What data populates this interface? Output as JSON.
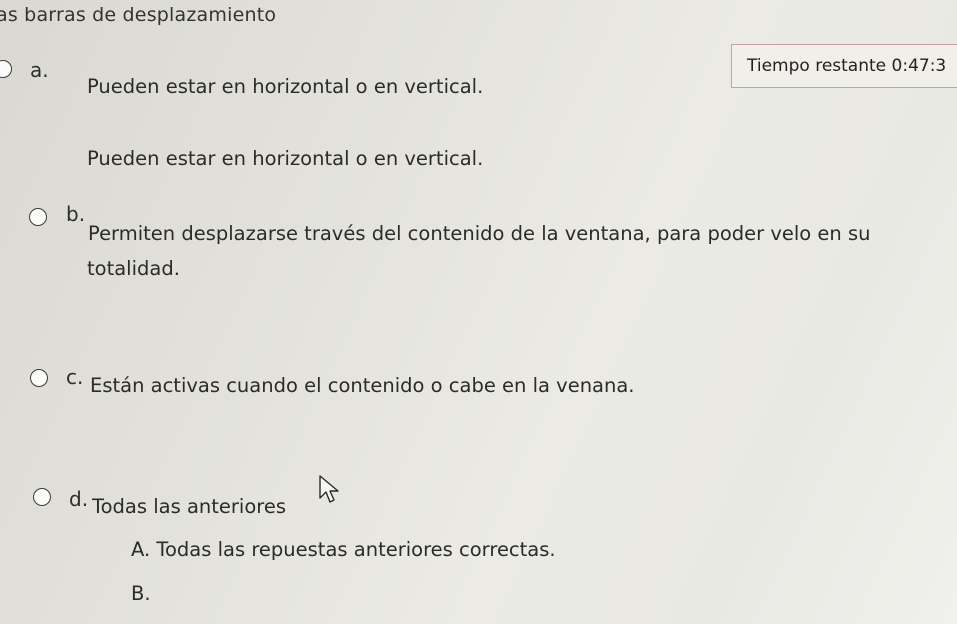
{
  "question": {
    "text": "as barras de desplazamiento"
  },
  "timer": {
    "label": "Tiempo restante",
    "value": "0:47:3"
  },
  "options": [
    {
      "letter": "a.",
      "text": "Pueden estar en horizontal o en vertical.",
      "extra": "Pueden estar en horizontal o en vertical."
    },
    {
      "letter": "b.",
      "text_line1": "Permiten desplazarse  través del contenido de la ventana, para poder velo en su",
      "text_line2": "totalidad."
    },
    {
      "letter": "c.",
      "text": "Están activas cuando el contenido o cabe en la venana."
    },
    {
      "letter": "d.",
      "text": "Todas las anteriores"
    }
  ],
  "answers": [
    {
      "text": "A. Todas las repuestas anteriores correctas."
    },
    {
      "text": "B."
    }
  ],
  "icons": {
    "cursor": "mouse-pointer-icon",
    "radio": "radio-button-icon"
  }
}
